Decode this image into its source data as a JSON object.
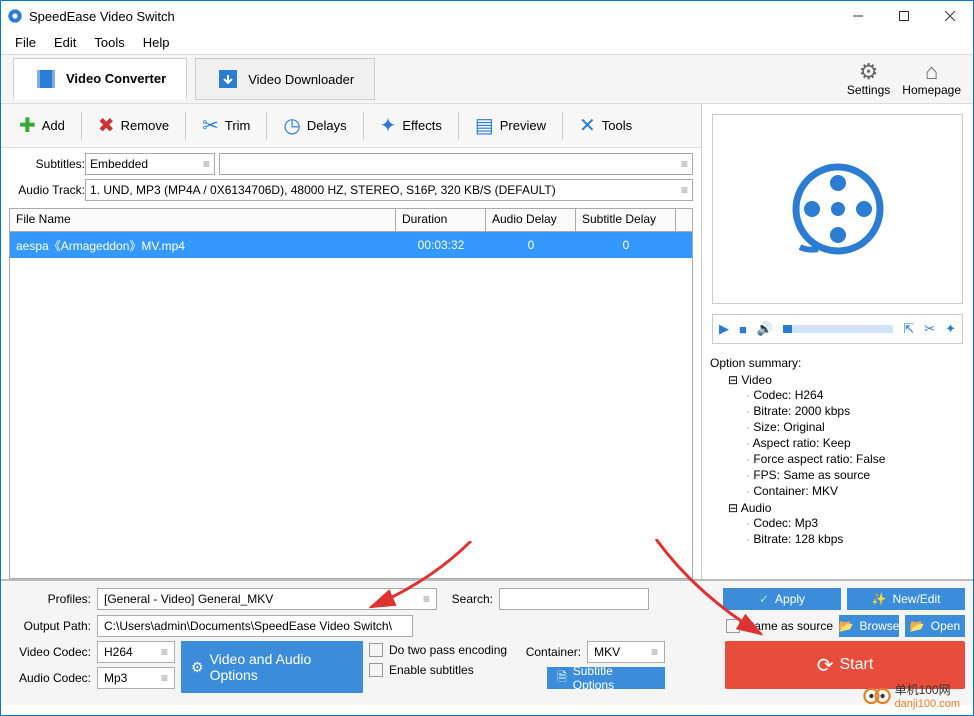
{
  "window": {
    "title": "SpeedEase Video Switch"
  },
  "menu": {
    "file": "File",
    "edit": "Edit",
    "tools": "Tools",
    "help": "Help"
  },
  "tabs": {
    "converter": "Video Converter",
    "downloader": "Video Downloader"
  },
  "header": {
    "settings": "Settings",
    "homepage": "Homepage"
  },
  "toolbar": {
    "add": "Add",
    "remove": "Remove",
    "trim": "Trim",
    "delays": "Delays",
    "effects": "Effects",
    "preview": "Preview",
    "tools": "Tools"
  },
  "subtrack": {
    "subtitles_label": "Subtitles:",
    "subtitles_value": "Embedded",
    "audiotrack_label": "Audio Track:",
    "audiotrack_value": "1. UND, MP3 (MP4A / 0X6134706D), 48000 HZ, STEREO, S16P, 320 KB/S (DEFAULT)"
  },
  "grid": {
    "file_name": "File Name",
    "duration": "Duration",
    "audio_delay": "Audio Delay",
    "subtitle_delay": "Subtitle Delay",
    "rows": [
      {
        "name": "aespa《Armageddon》MV.mp4",
        "duration": "00:03:32",
        "audio_delay": "0",
        "subtitle_delay": "0"
      }
    ]
  },
  "option_summary": {
    "title": "Option summary:",
    "video": {
      "label": "Video",
      "items": [
        "Codec: H264",
        "Bitrate: 2000 kbps",
        "Size:  Original",
        "Aspect ratio: Keep",
        "Force aspect ratio: False",
        "FPS: Same as source",
        "Container: MKV"
      ]
    },
    "audio": {
      "label": "Audio",
      "items": [
        "Codec: Mp3",
        "Bitrate: 128 kbps"
      ]
    }
  },
  "bottom": {
    "profiles_label": "Profiles:",
    "profiles_value": "[General - Video] General_MKV",
    "search_label": "Search:",
    "apply": "Apply",
    "newedit": "New/Edit",
    "output_label": "Output Path:",
    "output_value": "C:\\Users\\admin\\Documents\\SpeedEase Video Switch\\",
    "same_as_source": "Same as source",
    "browse": "Browse",
    "open": "Open",
    "video_codec_label": "Video Codec:",
    "video_codec_value": "H264",
    "audio_codec_label": "Audio Codec:",
    "audio_codec_value": "Mp3",
    "vao": "Video and Audio Options",
    "twopass": "Do two pass encoding",
    "enable_subs": "Enable subtitles",
    "container_label": "Container:",
    "container_value": "MKV",
    "subtitle_options": "Subtitle Options",
    "start": "Start"
  },
  "watermark": {
    "brand": "单机100网",
    "url": "danji100.com"
  }
}
